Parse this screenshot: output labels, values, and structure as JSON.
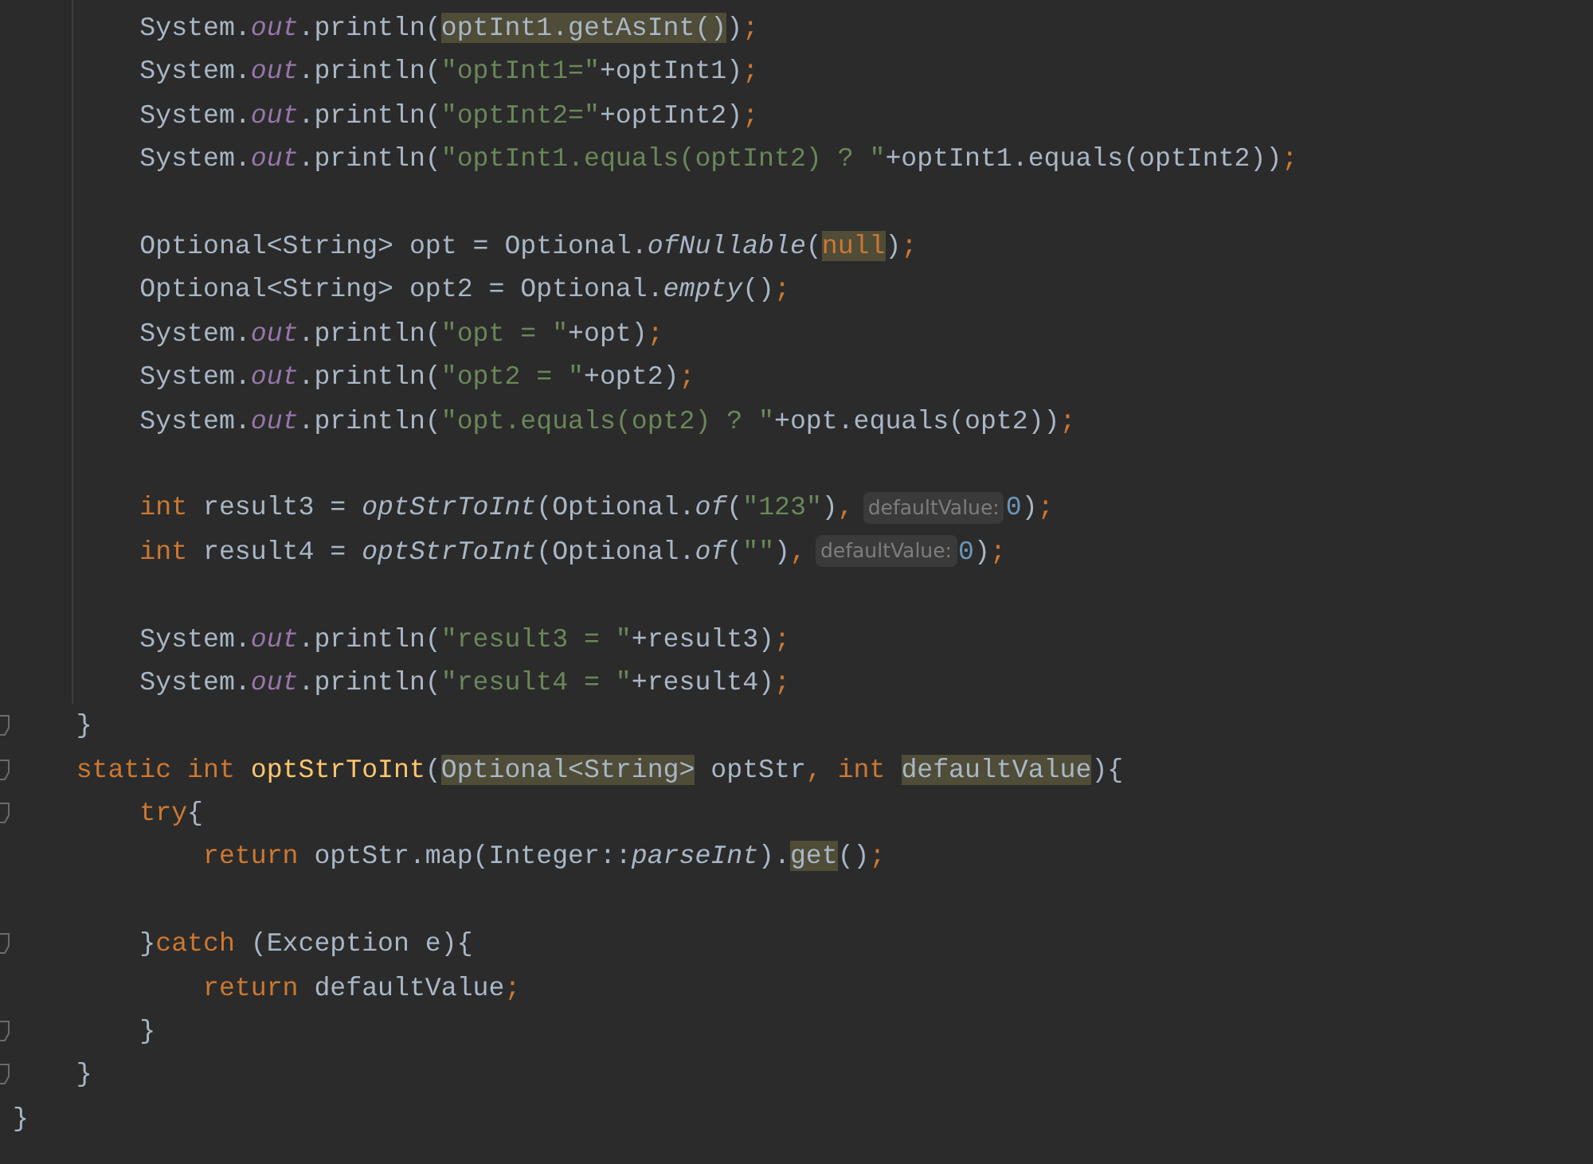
{
  "editor": {
    "lines": [
      {
        "fold": false,
        "segments": [
          {
            "kind": "code",
            "tokens": [
              {
                "t": "        System.",
                "kind": "plain"
              },
              {
                "t": "out",
                "kind": "field"
              },
              {
                "t": ".println(",
                "kind": "plain"
              },
              {
                "t": "optInt1.getAsInt()",
                "kind": "plain",
                "hl": true
              },
              {
                "t": ")",
                "kind": "plain"
              },
              {
                "t": ";",
                "kind": "keyword"
              }
            ]
          }
        ]
      },
      {
        "gap_before": false,
        "fold": false,
        "segments": [
          {
            "kind": "code",
            "tokens": [
              {
                "t": "        System.",
                "kind": "plain"
              },
              {
                "t": "out",
                "kind": "field"
              },
              {
                "t": ".println(",
                "kind": "plain"
              },
              {
                "t": "\"optInt1=\"",
                "kind": "string"
              },
              {
                "t": "+optInt1)",
                "kind": "plain"
              },
              {
                "t": ";",
                "kind": "keyword"
              }
            ]
          }
        ]
      },
      {
        "gap_before": false,
        "fold": false,
        "segments": [
          {
            "kind": "code",
            "tokens": [
              {
                "t": "        System.",
                "kind": "plain"
              },
              {
                "t": "out",
                "kind": "field"
              },
              {
                "t": ".println(",
                "kind": "plain"
              },
              {
                "t": "\"optInt2=\"",
                "kind": "string"
              },
              {
                "t": "+optInt2)",
                "kind": "plain"
              },
              {
                "t": ";",
                "kind": "keyword"
              }
            ]
          }
        ]
      },
      {
        "gap_before": false,
        "fold": false,
        "segments": [
          {
            "kind": "code",
            "tokens": [
              {
                "t": "        System.",
                "kind": "plain"
              },
              {
                "t": "out",
                "kind": "field"
              },
              {
                "t": ".println(",
                "kind": "plain"
              },
              {
                "t": "\"optInt1.equals(optInt2) ? \"",
                "kind": "string"
              },
              {
                "t": "+optInt1.equals(optInt2))",
                "kind": "plain"
              },
              {
                "t": ";",
                "kind": "keyword"
              }
            ]
          }
        ]
      },
      {
        "gap_before": true,
        "fold": false,
        "segments": [
          {
            "kind": "code",
            "tokens": [
              {
                "t": "        Optional<String> opt = Optional.",
                "kind": "plain"
              },
              {
                "t": "ofNullable",
                "kind": "italic"
              },
              {
                "t": "(",
                "kind": "plain"
              },
              {
                "t": "null",
                "kind": "keyword",
                "hl": true
              },
              {
                "t": ")",
                "kind": "plain"
              },
              {
                "t": ";",
                "kind": "keyword"
              }
            ]
          }
        ]
      },
      {
        "gap_before": false,
        "fold": false,
        "segments": [
          {
            "kind": "code",
            "tokens": [
              {
                "t": "        Optional<String> opt2 = Optional.",
                "kind": "plain"
              },
              {
                "t": "empty",
                "kind": "italic"
              },
              {
                "t": "()",
                "kind": "plain"
              },
              {
                "t": ";",
                "kind": "keyword"
              }
            ]
          }
        ]
      },
      {
        "gap_before": false,
        "fold": false,
        "segments": [
          {
            "kind": "code",
            "tokens": [
              {
                "t": "        System.",
                "kind": "plain"
              },
              {
                "t": "out",
                "kind": "field"
              },
              {
                "t": ".println(",
                "kind": "plain"
              },
              {
                "t": "\"opt = \"",
                "kind": "string"
              },
              {
                "t": "+opt)",
                "kind": "plain"
              },
              {
                "t": ";",
                "kind": "keyword"
              }
            ]
          }
        ]
      },
      {
        "gap_before": false,
        "fold": false,
        "segments": [
          {
            "kind": "code",
            "tokens": [
              {
                "t": "        System.",
                "kind": "plain"
              },
              {
                "t": "out",
                "kind": "field"
              },
              {
                "t": ".println(",
                "kind": "plain"
              },
              {
                "t": "\"opt2 = \"",
                "kind": "string"
              },
              {
                "t": "+opt2)",
                "kind": "plain"
              },
              {
                "t": ";",
                "kind": "keyword"
              }
            ]
          }
        ]
      },
      {
        "gap_before": false,
        "fold": false,
        "segments": [
          {
            "kind": "code",
            "tokens": [
              {
                "t": "        System.",
                "kind": "plain"
              },
              {
                "t": "out",
                "kind": "field"
              },
              {
                "t": ".println(",
                "kind": "plain"
              },
              {
                "t": "\"opt.equals(opt2) ? \"",
                "kind": "string"
              },
              {
                "t": "+opt.equals(opt2))",
                "kind": "plain"
              },
              {
                "t": ";",
                "kind": "keyword"
              }
            ]
          }
        ]
      },
      {
        "gap_before": true,
        "fold": false,
        "segments": [
          {
            "kind": "code",
            "tokens": [
              {
                "t": "        int",
                "kind": "keyword"
              },
              {
                "t": " result3 = ",
                "kind": "plain"
              },
              {
                "t": "optStrToInt",
                "kind": "italic"
              },
              {
                "t": "(Optional.",
                "kind": "plain"
              },
              {
                "t": "of",
                "kind": "italic"
              },
              {
                "t": "(",
                "kind": "plain"
              },
              {
                "t": "\"123\"",
                "kind": "string"
              },
              {
                "t": ")",
                "kind": "plain"
              },
              {
                "t": ",",
                "kind": "keyword"
              }
            ]
          },
          {
            "kind": "hint",
            "text": "defaultValue:"
          },
          {
            "kind": "code",
            "tokens": [
              {
                "t": "0",
                "kind": "number"
              },
              {
                "t": ")",
                "kind": "plain"
              },
              {
                "t": ";",
                "kind": "keyword"
              }
            ]
          }
        ]
      },
      {
        "gap_before": false,
        "fold": false,
        "segments": [
          {
            "kind": "code",
            "tokens": [
              {
                "t": "        int",
                "kind": "keyword"
              },
              {
                "t": " result4 = ",
                "kind": "plain"
              },
              {
                "t": "optStrToInt",
                "kind": "italic"
              },
              {
                "t": "(Optional.",
                "kind": "plain"
              },
              {
                "t": "of",
                "kind": "italic"
              },
              {
                "t": "(",
                "kind": "plain"
              },
              {
                "t": "\"\"",
                "kind": "string"
              },
              {
                "t": ")",
                "kind": "plain"
              },
              {
                "t": ",",
                "kind": "keyword"
              }
            ]
          },
          {
            "kind": "hint",
            "text": "defaultValue:"
          },
          {
            "kind": "code",
            "tokens": [
              {
                "t": "0",
                "kind": "number"
              },
              {
                "t": ")",
                "kind": "plain"
              },
              {
                "t": ";",
                "kind": "keyword"
              }
            ]
          }
        ]
      },
      {
        "gap_before": true,
        "fold": false,
        "segments": [
          {
            "kind": "code",
            "tokens": [
              {
                "t": "        System.",
                "kind": "plain"
              },
              {
                "t": "out",
                "kind": "field"
              },
              {
                "t": ".println(",
                "kind": "plain"
              },
              {
                "t": "\"result3 = \"",
                "kind": "string"
              },
              {
                "t": "+result3)",
                "kind": "plain"
              },
              {
                "t": ";",
                "kind": "keyword"
              }
            ]
          }
        ]
      },
      {
        "gap_before": false,
        "fold": false,
        "segments": [
          {
            "kind": "code",
            "tokens": [
              {
                "t": "        System.",
                "kind": "plain"
              },
              {
                "t": "out",
                "kind": "field"
              },
              {
                "t": ".println(",
                "kind": "plain"
              },
              {
                "t": "\"result4 = \"",
                "kind": "string"
              },
              {
                "t": "+result4)",
                "kind": "plain"
              },
              {
                "t": ";",
                "kind": "keyword"
              }
            ]
          }
        ]
      },
      {
        "gap_before": false,
        "fold": true,
        "segments": [
          {
            "kind": "code",
            "tokens": [
              {
                "t": "    }",
                "kind": "plain"
              }
            ]
          }
        ]
      },
      {
        "gap_before": false,
        "fold": true,
        "segments": [
          {
            "kind": "code",
            "tokens": [
              {
                "t": "    static int ",
                "kind": "keyword"
              },
              {
                "t": "optStrToInt",
                "kind": "decl"
              },
              {
                "t": "(",
                "kind": "plain"
              },
              {
                "t": "Optional<String>",
                "kind": "plain",
                "hl": true
              },
              {
                "t": " optStr",
                "kind": "plain"
              },
              {
                "t": ", int ",
                "kind": "keyword"
              },
              {
                "t": "defaultValue",
                "kind": "plain",
                "hl": true
              },
              {
                "t": "){",
                "kind": "plain"
              }
            ]
          }
        ]
      },
      {
        "gap_before": false,
        "fold": true,
        "segments": [
          {
            "kind": "code",
            "tokens": [
              {
                "t": "        try",
                "kind": "keyword"
              },
              {
                "t": "{",
                "kind": "plain"
              }
            ]
          }
        ]
      },
      {
        "gap_before": false,
        "fold": false,
        "segments": [
          {
            "kind": "code",
            "tokens": [
              {
                "t": "            return",
                "kind": "keyword"
              },
              {
                "t": " optStr.map(Integer::",
                "kind": "plain"
              },
              {
                "t": "parseInt",
                "kind": "italic"
              },
              {
                "t": ").",
                "kind": "plain"
              },
              {
                "t": "get",
                "kind": "plain",
                "hl": true
              },
              {
                "t": "()",
                "kind": "plain"
              },
              {
                "t": ";",
                "kind": "keyword"
              }
            ]
          }
        ]
      },
      {
        "gap_before": true,
        "fold": true,
        "segments": [
          {
            "kind": "code",
            "tokens": [
              {
                "t": "        }",
                "kind": "plain"
              },
              {
                "t": "catch",
                "kind": "keyword"
              },
              {
                "t": " (Exception e){",
                "kind": "plain"
              }
            ]
          }
        ]
      },
      {
        "gap_before": false,
        "fold": false,
        "segments": [
          {
            "kind": "code",
            "tokens": [
              {
                "t": "            return",
                "kind": "keyword"
              },
              {
                "t": " defaultValue",
                "kind": "plain"
              },
              {
                "t": ";",
                "kind": "keyword"
              }
            ]
          }
        ]
      },
      {
        "gap_before": false,
        "fold": true,
        "segments": [
          {
            "kind": "code",
            "tokens": [
              {
                "t": "        }",
                "kind": "plain"
              }
            ]
          }
        ]
      },
      {
        "gap_before": false,
        "fold": true,
        "segments": [
          {
            "kind": "code",
            "tokens": [
              {
                "t": "    }",
                "kind": "plain"
              }
            ]
          }
        ]
      },
      {
        "gap_before": false,
        "fold": false,
        "segments": [
          {
            "kind": "code",
            "tokens": [
              {
                "t": "}",
                "kind": "plain"
              }
            ]
          }
        ]
      }
    ]
  }
}
